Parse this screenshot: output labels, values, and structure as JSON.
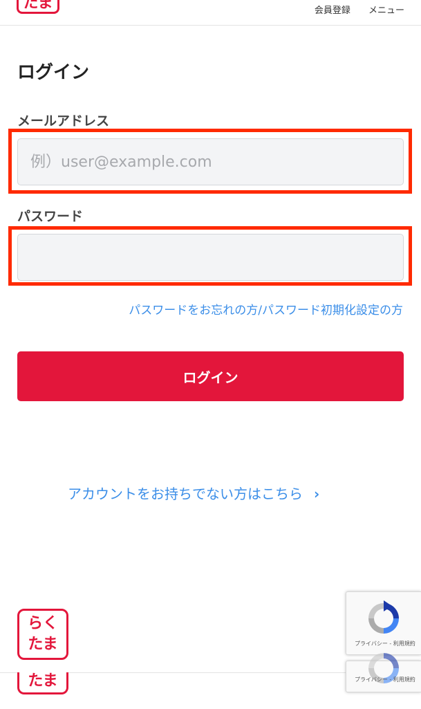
{
  "header": {
    "logo_text": "たま",
    "register_label": "会員登録",
    "menu_label": "メニュー"
  },
  "page": {
    "title": "ログイン"
  },
  "form": {
    "email_label": "メールアドレス",
    "email_placeholder": "例）user@example.com",
    "email_value": "",
    "password_label": "パスワード",
    "password_value": "",
    "forgot_link": "パスワードをお忘れの方/パスワード初期化設定の方",
    "login_button": "ログイン"
  },
  "signup": {
    "link_text": "アカウントをお持ちでない方はこちら",
    "chevron": "›"
  },
  "footer": {
    "logo_line1": "らく",
    "logo_line2": "たま",
    "strip_logo_text": "たま"
  },
  "recaptcha": {
    "terms_text": "プライバシー - 利用規約"
  },
  "colors": {
    "brand_red": "#e3163b",
    "link_blue": "#3b8ee8",
    "highlight_red": "#ff2a00",
    "input_bg": "#f3f4f6"
  }
}
